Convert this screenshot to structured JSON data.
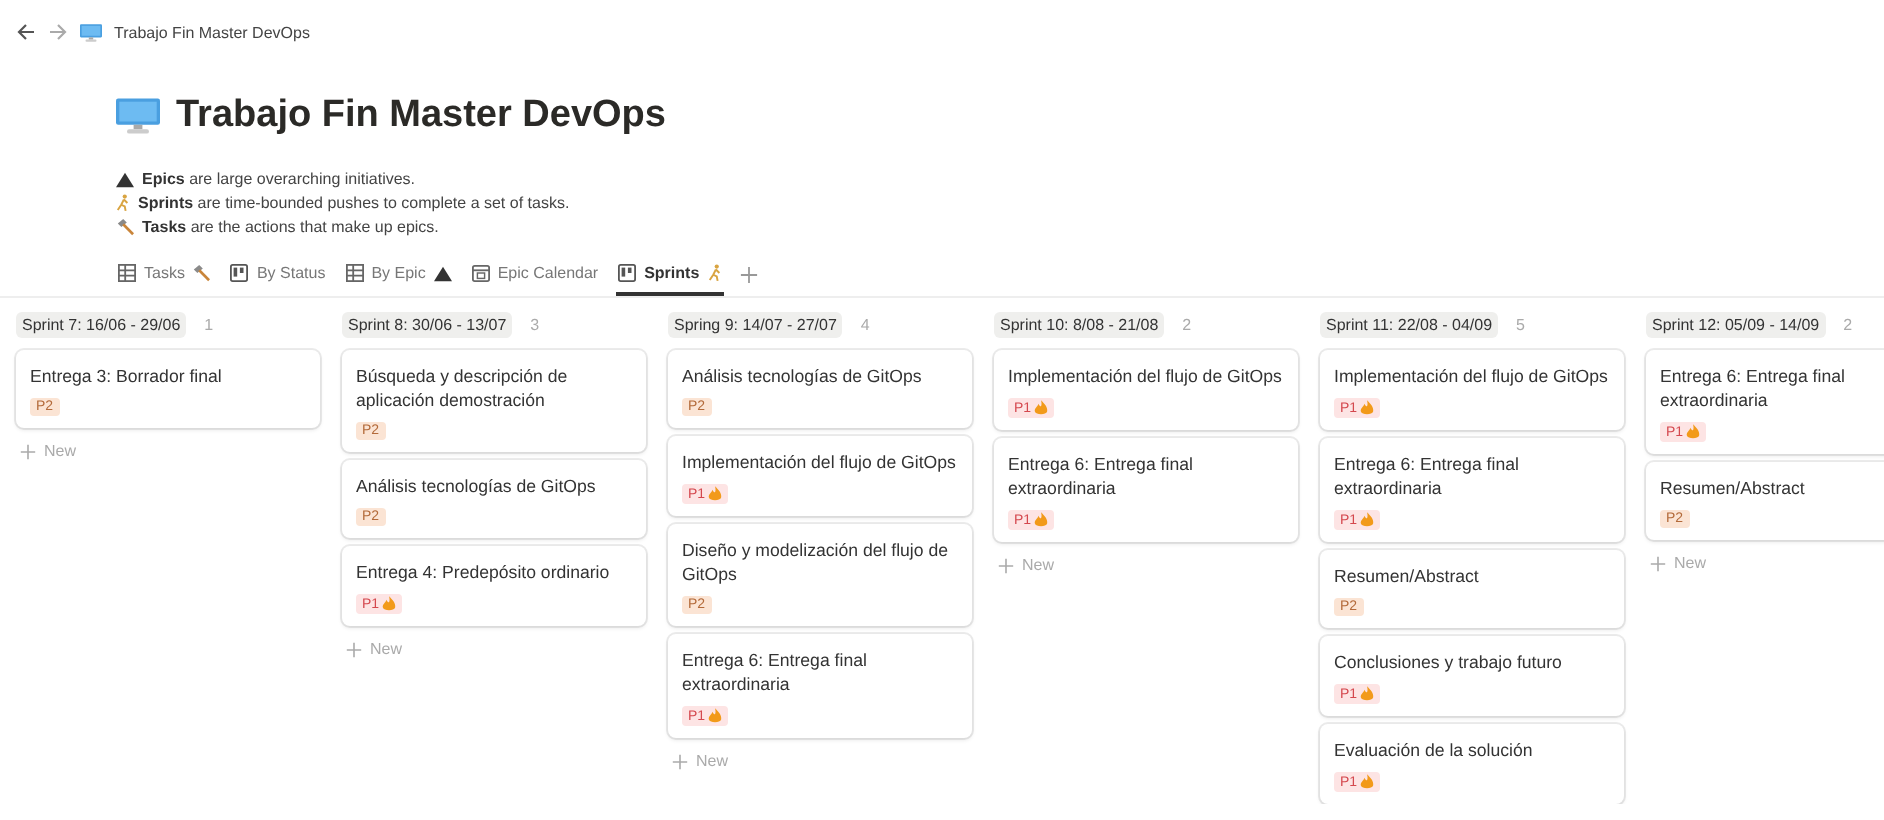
{
  "breadcrumb": {
    "title": "Trabajo Fin Master DevOps"
  },
  "page": {
    "title": "Trabajo Fin Master DevOps"
  },
  "descriptions": [
    {
      "text": "**Epics** are large overarching initiatives."
    },
    {
      "text": "**Sprints** are time-bounded pushes to complete a set of tasks."
    },
    {
      "text": "**Tasks** are the actions that make up epics."
    }
  ],
  "tabs": [
    {
      "label": "Tasks",
      "selected": false
    },
    {
      "label": "By Status",
      "selected": false
    },
    {
      "label": "By Epic",
      "selected": false
    },
    {
      "label": "Epic Calendar",
      "selected": false
    },
    {
      "label": "Sprints",
      "selected": true
    }
  ],
  "columns": [
    {
      "title": "Sprint 7: 16/06 - 29/06",
      "count": "1",
      "cards": [
        {
          "title": "Entrega 3: Borrador final",
          "tag": {
            "label": "P2",
            "color": "#fbe4d4",
            "fire": false
          }
        }
      ],
      "new_label": "New"
    },
    {
      "title": "Sprint 8: 30/06 - 13/07",
      "count": "3",
      "cards": [
        {
          "title": "Búsqueda y descripción de aplicación demostración",
          "tag": {
            "label": "P2",
            "color": "#fbe4d4",
            "fire": false
          }
        },
        {
          "title": "Análisis tecnologías de GitOps",
          "tag": {
            "label": "P2",
            "color": "#fbe4d4",
            "fire": false
          }
        },
        {
          "title": "Entrega 4: Predepósito ordinario",
          "tag": {
            "label": "P1",
            "color": "#fde4e4",
            "fire": true
          }
        }
      ],
      "new_label": "New"
    },
    {
      "title": "Spring 9: 14/07 - 27/07",
      "count": "4",
      "cards": [
        {
          "title": "Análisis tecnologías de GitOps",
          "tag": {
            "label": "P2",
            "color": "#fbe4d4",
            "fire": false
          }
        },
        {
          "title": "Implementación del flujo de GitOps",
          "tag": {
            "label": "P1",
            "color": "#fde4e4",
            "fire": true
          }
        },
        {
          "title": "Diseño y modelización del flujo de GitOps",
          "tag": {
            "label": "P2",
            "color": "#fbe4d4",
            "fire": false
          }
        },
        {
          "title": "Entrega 6: Entrega final extraordinaria",
          "tag": {
            "label": "P1",
            "color": "#fde4e4",
            "fire": true
          }
        }
      ],
      "new_label": "New"
    },
    {
      "title": "Sprint 10: 8/08 - 21/08",
      "count": "2",
      "cards": [
        {
          "title": "Implementación del flujo de GitOps",
          "tag": {
            "label": "P1",
            "color": "#fde4e4",
            "fire": true
          }
        },
        {
          "title": "Entrega 6: Entrega final extraordinaria",
          "tag": {
            "label": "P1",
            "color": "#fde4e4",
            "fire": true
          }
        }
      ],
      "new_label": "New"
    },
    {
      "title": "Sprint 11: 22/08 - 04/09",
      "count": "5",
      "cards": [
        {
          "title": "Implementación del flujo de GitOps",
          "tag": {
            "label": "P1",
            "color": "#fde4e4",
            "fire": true
          }
        },
        {
          "title": "Entrega 6: Entrega final extraordinaria",
          "tag": {
            "label": "P1",
            "color": "#fde4e4",
            "fire": true
          }
        },
        {
          "title": "Resumen/Abstract",
          "tag": {
            "label": "P2",
            "color": "#fbe4d4",
            "fire": false
          }
        },
        {
          "title": "Conclusiones y trabajo futuro",
          "tag": {
            "label": "P1",
            "color": "#fde4e4",
            "fire": true
          }
        },
        {
          "title": "Evaluación de la solución",
          "tag": {
            "label": "P1",
            "color": "#fde4e4",
            "fire": true
          }
        }
      ]
    },
    {
      "title": "Sprint 12: 05/09 - 14/09",
      "count": "2",
      "cards": [
        {
          "title": "Entrega 6: Entrega final extraordinaria",
          "tag": {
            "label": "P1",
            "color": "#fde4e4",
            "fire": true
          }
        },
        {
          "title": "Resumen/Abstract",
          "tag": {
            "label": "P2",
            "color": "#fbe4d4",
            "fire": false
          }
        }
      ],
      "new_label": "New"
    }
  ]
}
